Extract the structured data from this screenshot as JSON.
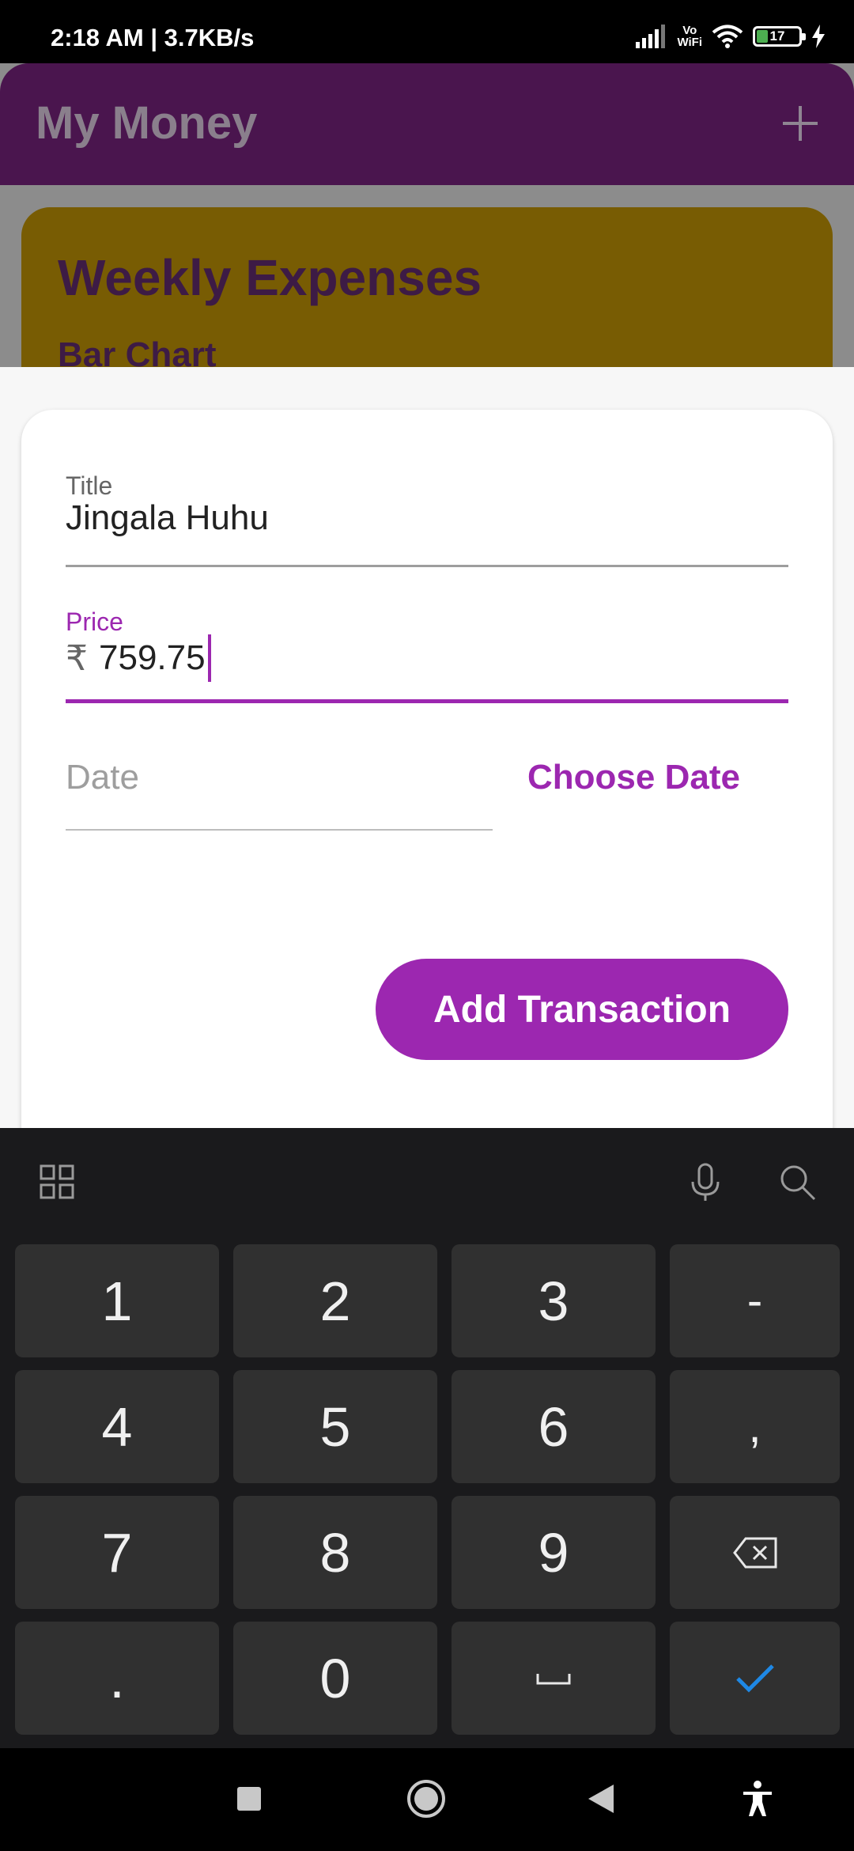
{
  "status_bar": {
    "time": "2:18 AM | 3.7KB/s",
    "vowifi_top": "Vo",
    "vowifi_bottom": "WiFi",
    "battery": "17"
  },
  "app": {
    "title": "My Money",
    "add_icon": "plus-icon",
    "card_title": "Weekly Expenses",
    "card_subtitle": "Bar Chart"
  },
  "form": {
    "title_label": "Title",
    "title_value": "Jingala Huhu",
    "price_label": "Price",
    "price_prefix": "₹",
    "price_value": "759.75",
    "date_placeholder": "Date",
    "choose_date": "Choose Date",
    "submit": "Add Transaction"
  },
  "keyboard": {
    "toolbar_icons": [
      "grid-icon",
      "mic-icon",
      "search-icon"
    ],
    "keys": [
      "1",
      "2",
      "3",
      "-",
      "4",
      "5",
      "6",
      ",",
      "7",
      "8",
      "9",
      "backspace",
      ".",
      "0",
      "space",
      "done"
    ]
  },
  "nav_bar": {
    "icons": [
      "recents-icon",
      "home-icon",
      "back-icon",
      "accessibility-icon"
    ]
  },
  "colors": {
    "accent": "#9c27b0",
    "app_bar": "#4a154e",
    "card": "#785c03"
  }
}
